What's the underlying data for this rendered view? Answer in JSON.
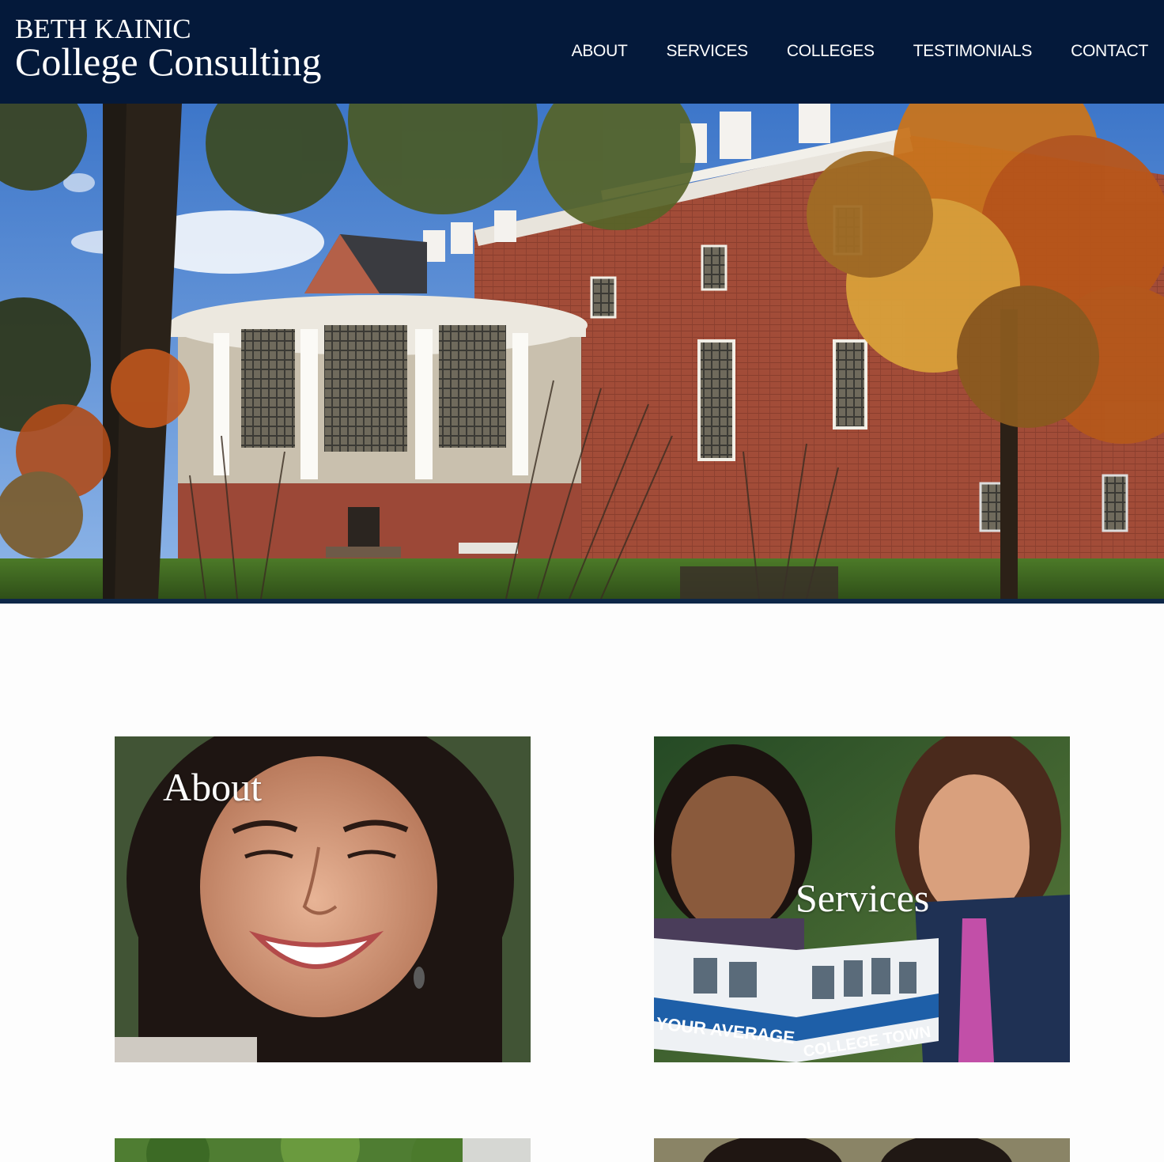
{
  "brand": {
    "line1": "BETH KAINIC",
    "line2": "College Consulting"
  },
  "nav": {
    "items": [
      "ABOUT",
      "SERVICES",
      "COLLEGES",
      "TESTIMONIALS",
      "CONTACT"
    ]
  },
  "tiles": {
    "about": {
      "label": "About"
    },
    "services": {
      "label": "Services",
      "magazine_text_1": "YOUR AVERAGE",
      "magazine_text_2": "COLLEGE TOWN"
    }
  },
  "colors": {
    "header_bg": "#04193a",
    "nav_text": "#ffffff",
    "page_bg": "#fdfdfd"
  }
}
